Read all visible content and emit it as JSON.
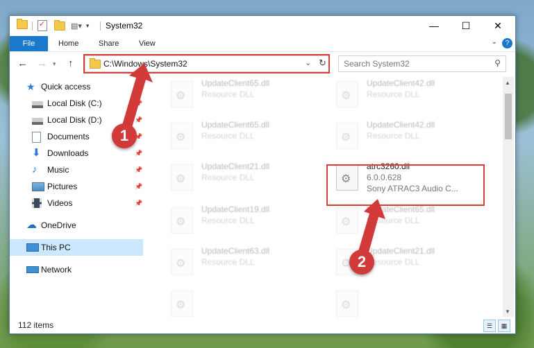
{
  "window": {
    "title": "System32"
  },
  "ribbon": {
    "tabs": [
      "File",
      "Home",
      "Share",
      "View"
    ]
  },
  "address": {
    "path": "C:\\Windows\\System32"
  },
  "search": {
    "placeholder": "Search System32"
  },
  "navpane": {
    "items": [
      {
        "label": "Quick access",
        "icon": "star-icon"
      },
      {
        "label": "Local Disk (C:)",
        "icon": "drive-icon",
        "pinned": true
      },
      {
        "label": "Local Disk (D:)",
        "icon": "drive-icon",
        "pinned": true
      },
      {
        "label": "Documents",
        "icon": "documents-icon",
        "pinned": true
      },
      {
        "label": "Downloads",
        "icon": "download-icon",
        "pinned": true
      },
      {
        "label": "Music",
        "icon": "music-icon",
        "pinned": true
      },
      {
        "label": "Pictures",
        "icon": "pictures-icon",
        "pinned": true
      },
      {
        "label": "Videos",
        "icon": "videos-icon",
        "pinned": true
      },
      {
        "label": "OneDrive",
        "icon": "cloud-icon"
      },
      {
        "label": "This PC",
        "icon": "computer-icon",
        "selected": true
      },
      {
        "label": "Network",
        "icon": "network-icon"
      }
    ]
  },
  "files": [
    {
      "name": "UpdateClient65.dll",
      "desc": "Resource DLL"
    },
    {
      "name": "UpdateClient42.dll",
      "desc": "Resource DLL"
    },
    {
      "name": "UpdateClient65.dll",
      "desc": "Resource DLL"
    },
    {
      "name": "UpdateClient42.dll",
      "desc": "Resource DLL"
    },
    {
      "name": "UpdateClient21.dll",
      "desc": "Resource DLL"
    },
    {
      "name": "atrc3260.dll",
      "desc": "6.0.0.628",
      "desc2": "Sony ATRAC3 Audio C..."
    },
    {
      "name": "UpdateClient19.dll",
      "desc": "Resource DLL"
    },
    {
      "name": "UpdateClient65.dll",
      "desc": "Resource DLL"
    },
    {
      "name": "UpdateClient63.dll",
      "desc": "Resource DLL"
    },
    {
      "name": "UpdateClient21.dll",
      "desc": "Resource DLL"
    },
    {
      "name": "",
      "desc": ""
    },
    {
      "name": "",
      "desc": ""
    }
  ],
  "status": {
    "item_count": "112 items"
  },
  "annotations": {
    "badge1": "1",
    "badge2": "2"
  },
  "colors": {
    "accent": "#1979ca",
    "annotation": "#d23a3a",
    "selected": "#cce8ff"
  }
}
